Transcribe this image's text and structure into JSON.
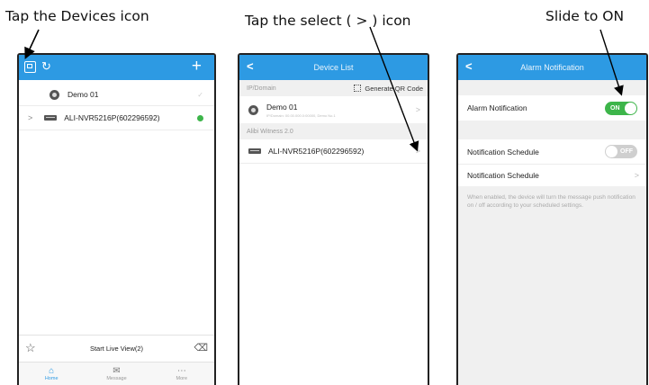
{
  "captions": {
    "step1": "Tap the Devices icon",
    "step2": "Tap the select ( > ) icon",
    "step3": "Slide to ON"
  },
  "screen1": {
    "plus": "+",
    "devices": [
      {
        "name": "Demo 01",
        "type": "camera",
        "status": "check"
      },
      {
        "name": "ALI-NVR5216P(602296592)",
        "type": "nvr",
        "status": "online"
      }
    ],
    "expand_glyph": ">",
    "start_live_view": "Start Live View(2)",
    "tabs": [
      {
        "label": "Home",
        "icon": "home-icon",
        "active": true
      },
      {
        "label": "Message",
        "icon": "message-icon",
        "active": false
      },
      {
        "label": "More",
        "icon": "more-icon",
        "active": false
      }
    ],
    "colors": {
      "accent": "#2d9ae3",
      "online": "#3db54a"
    }
  },
  "screen2": {
    "title": "Device List",
    "back": "<",
    "section1": "IP/Domain",
    "generate_qr": "Generate QR Code",
    "device1_name": "Demo 01",
    "device1_sub": "IP/Domain: 00.00.000.0:00000, Demo No.1",
    "section2": "Alibi Witness 2.0",
    "device2_name": "ALI-NVR5216P(602296592)",
    "chevron": ">"
  },
  "screen3": {
    "title": "Alarm Notification",
    "back": "<",
    "alarm_label": "Alarm Notification",
    "alarm_state": "ON",
    "schedule_toggle_label": "Notification Schedule",
    "schedule_state": "OFF",
    "schedule_link_label": "Notification Schedule",
    "chevron": ">",
    "help_text": "When enabled, the device will turn the message push notification on / off according to your scheduled settings."
  }
}
